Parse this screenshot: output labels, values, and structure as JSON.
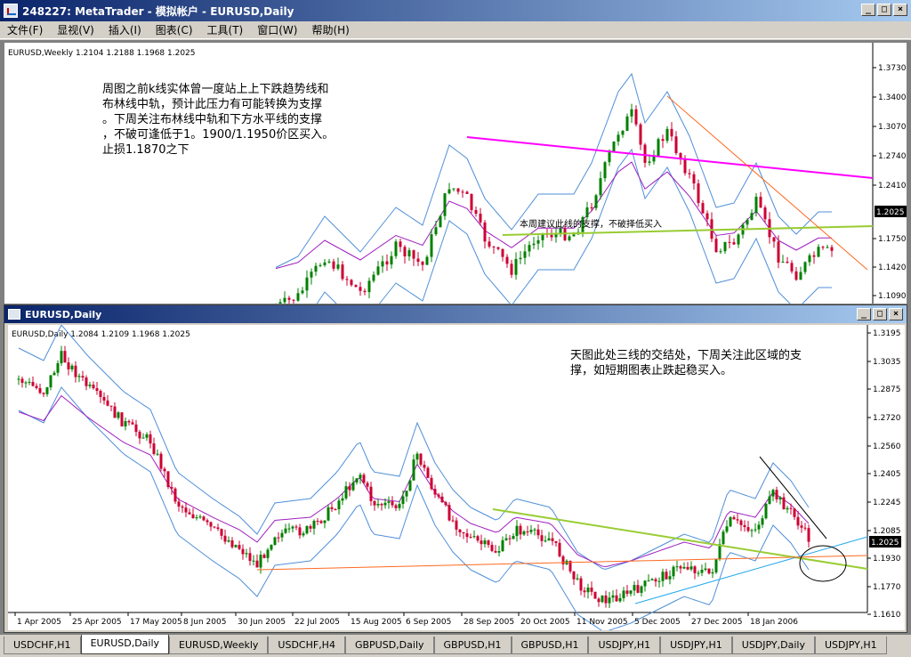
{
  "window": {
    "title": "248227: MetaTrader - 模拟帐户 - EURUSD,Daily",
    "minimize": "_",
    "restore": "□",
    "close": "×"
  },
  "menu": [
    "文件(F)",
    "显视(V)",
    "插入(I)",
    "图表(C)",
    "工具(T)",
    "窗口(W)",
    "帮助(H)"
  ],
  "weekly_chart": {
    "header": "EURUSD,Weekly  1.2104 1.2188 1.1968 1.2025",
    "annotation": "周图之前k线实体曾一度站上上下跌趋势线和\n布林线中轨，预计此压力有可能转换为支撑\n。下周关注布林线中轨和下方水平线的支撑\n，不破可逢低于1。1900/1.1950价区买入。\n止损1.1870之下",
    "support_note": "本周建议此线的支撑，不破择低买入",
    "current_price": "1.2025",
    "price_ticks": [
      "1.3730",
      "1.3400",
      "1.3070",
      "1.2740",
      "1.2410",
      "1.2025",
      "1.1750",
      "1.1420",
      "1.1090"
    ]
  },
  "daily_window": {
    "title": "EURUSD,Daily",
    "header": "EURUSD,Daily  1.2084 1.2109 1.1968 1.2025",
    "annotation": "天图此处三线的交结处，下周关注此区域的支\n撑，如短期图表止跌起稳买入。",
    "current_price": "1.2025",
    "price_ticks": [
      "1.3195",
      "1.3035",
      "1.2875",
      "1.2720",
      "1.2560",
      "1.2405",
      "1.2245",
      "1.2085",
      "1.1930",
      "1.1770",
      "1.1610"
    ],
    "date_ticks": [
      "1 Apr 2005",
      "25 Apr 2005",
      "17 May 2005",
      "8 Jun 2005",
      "30 Jun 2005",
      "22 Jul 2005",
      "15 Aug 2005",
      "6 Sep 2005",
      "28 Sep 2005",
      "20 Oct 2005",
      "11 Nov 2005",
      "5 Dec 2005",
      "27 Dec 2005",
      "18 Jan 2006"
    ]
  },
  "tabs": [
    {
      "label": "USDCHF,H1",
      "active": false
    },
    {
      "label": "EURUSD,Daily",
      "active": true
    },
    {
      "label": "EURUSD,Weekly",
      "active": false
    },
    {
      "label": "USDCHF,H4",
      "active": false
    },
    {
      "label": "GBPUSD,Daily",
      "active": false
    },
    {
      "label": "GBPUSD,H1",
      "active": false
    },
    {
      "label": "GBPUSD,H1",
      "active": false
    },
    {
      "label": "USDJPY,H1",
      "active": false
    },
    {
      "label": "USDJPY,H1",
      "active": false
    },
    {
      "label": "USDJPY,Daily",
      "active": false
    },
    {
      "label": "USDJPY,H1",
      "active": false
    }
  ],
  "colors": {
    "bull_candle": "#008000",
    "bear_candle": "#cc0033",
    "bollinger": "#4f8fd9",
    "ma": "#a020c0",
    "trend_magenta": "#ff00ff",
    "trend_green": "#99cc33",
    "trend_orange": "#ff6a20",
    "trend_cyan": "#22aaee"
  }
}
